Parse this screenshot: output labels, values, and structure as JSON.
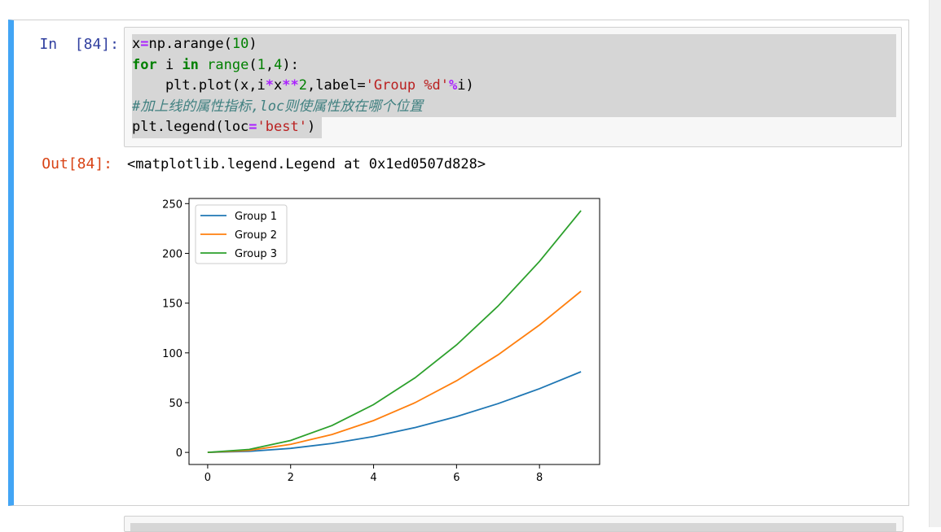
{
  "cell": {
    "in_prompt": "In  [84]:",
    "out_prompt": "Out[84]:",
    "output_text": "<matplotlib.legend.Legend at 0x1ed0507d828>",
    "code": {
      "line1": {
        "a": "x",
        "eq": "=",
        "b": "np.arange(",
        "n": "10",
        "c": ")"
      },
      "line2": {
        "kw1": "for",
        "sp1": " i ",
        "kw2": "in",
        "sp2": " ",
        "bi": "range",
        "a": "(",
        "n1": "1",
        "comma": ",",
        "n2": "4",
        "b": "):"
      },
      "line3": {
        "indent": "    plt.plot(x,i",
        "op1": "*",
        "x": "x",
        "op2": "**",
        "n": "2",
        "a": ",label=",
        "s": "'Group %d'",
        "op3": "%",
        "b": "i)"
      },
      "line4": {
        "comment": "#加上线的属性指标,loc则使属性放在哪个位置"
      },
      "line5": {
        "a": "plt.legend(loc",
        "eq": "=",
        "s": "'best'",
        "b": ")"
      }
    }
  },
  "chart_data": {
    "type": "line",
    "x": [
      0,
      1,
      2,
      3,
      4,
      5,
      6,
      7,
      8,
      9
    ],
    "series": [
      {
        "name": "Group 1",
        "color": "#1f77b4",
        "values": [
          0,
          1,
          4,
          9,
          16,
          25,
          36,
          49,
          64,
          81
        ]
      },
      {
        "name": "Group 2",
        "color": "#ff7f0e",
        "values": [
          0,
          2,
          8,
          18,
          32,
          50,
          72,
          98,
          128,
          162
        ]
      },
      {
        "name": "Group 3",
        "color": "#2ca02c",
        "values": [
          0,
          3,
          12,
          27,
          48,
          75,
          108,
          147,
          192,
          243
        ]
      }
    ],
    "xlim": [
      -0.45,
      9.45
    ],
    "ylim": [
      -12.15,
      255.15
    ],
    "xticks": [
      0,
      2,
      4,
      6,
      8
    ],
    "yticks": [
      0,
      50,
      100,
      150,
      200,
      250
    ],
    "legend_position": "upper-left",
    "grid": false
  }
}
